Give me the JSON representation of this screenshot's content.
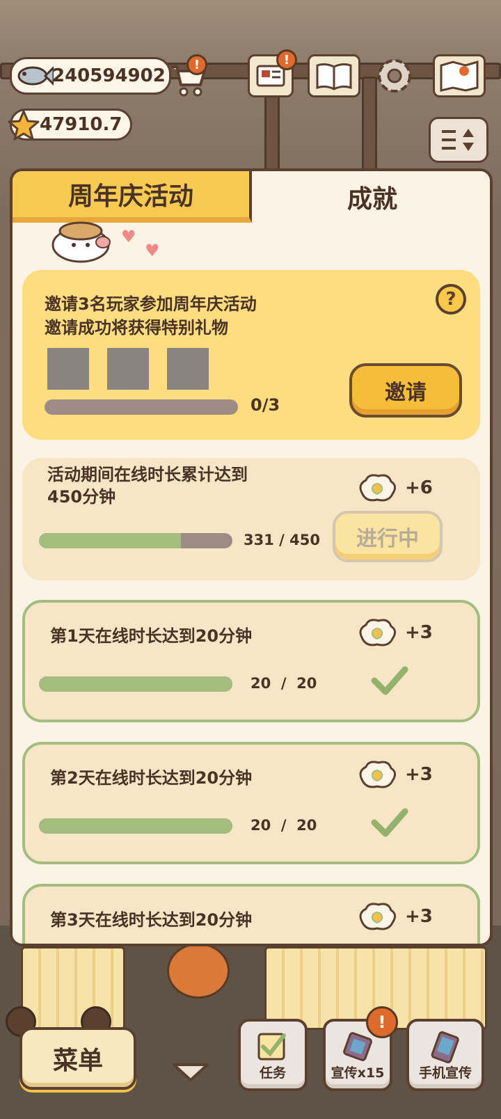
{
  "hud": {
    "fish_count": "240594902",
    "star_count": "47910.7"
  },
  "tabs": [
    {
      "label": "周年庆活动",
      "active": true
    },
    {
      "label": "成就",
      "active": false
    }
  ],
  "invite": {
    "title_line1": "邀请3名玩家参加周年庆活动",
    "title_line2": "邀请成功将获得特别礼物",
    "progress_text": "0/3",
    "progress": 0,
    "button_label": "邀请",
    "help_symbol": "?"
  },
  "tasks": [
    {
      "title_line1": "活动期间在线时长累计达到",
      "title_line2": "450分钟",
      "reward": "+6",
      "current": "331",
      "total": "450",
      "progress": 0.7356,
      "status_label": "进行中",
      "completed": false
    },
    {
      "title": "第1天在线时长达到20分钟",
      "reward": "+3",
      "current": "20",
      "total": "20",
      "progress": 1,
      "completed": true
    },
    {
      "title": "第2天在线时长达到20分钟",
      "reward": "+3",
      "current": "20",
      "total": "20",
      "progress": 1,
      "completed": true
    },
    {
      "title": "第3天在线时长达到20分钟",
      "reward": "+3",
      "completed": true
    }
  ],
  "bottom_bar": {
    "menu_label": "菜单",
    "task_label": "任务",
    "promo_label": "宣传x15",
    "phone_promo_label": "手机宣传",
    "alert_symbol": "!"
  },
  "colors": {
    "accent_yellow": "#f8ca52",
    "progress_green": "#a3bd7e",
    "progress_track": "#9d8c86",
    "panel_bg": "#fbf3e6",
    "border_brown": "#5b4030"
  },
  "icons": [
    "fish-icon",
    "star-icon",
    "shopping-cart-icon",
    "mail-icon",
    "book-icon",
    "gear-icon",
    "map-icon",
    "sort-icon",
    "help-icon",
    "popcorn-reward-icon",
    "check-icon",
    "paw-icon",
    "chevron-down-icon"
  ]
}
